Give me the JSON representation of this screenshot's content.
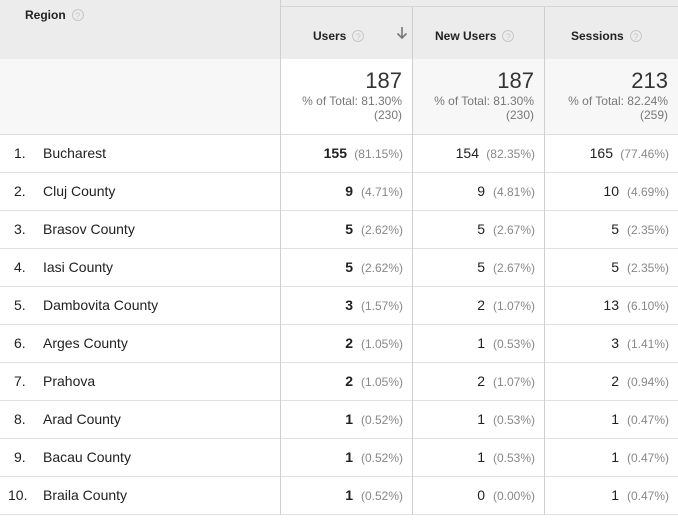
{
  "columns": {
    "region": "Region",
    "users": "Users",
    "new_users": "New Users",
    "sessions": "Sessions",
    "help_glyph": "?"
  },
  "totals": {
    "users": {
      "value": "187",
      "pct": "% of Total: 81.30%",
      "base": "(230)"
    },
    "new_users": {
      "value": "187",
      "pct": "% of Total: 81.30%",
      "base": "(230)"
    },
    "sessions": {
      "value": "213",
      "pct": "% of Total: 82.24%",
      "base": "(259)"
    }
  },
  "rows": [
    {
      "idx": "1.",
      "region": "Bucharest",
      "users": "155",
      "users_pct": "(81.15%)",
      "new": "154",
      "new_pct": "(82.35%)",
      "sess": "165",
      "sess_pct": "(77.46%)"
    },
    {
      "idx": "2.",
      "region": "Cluj County",
      "users": "9",
      "users_pct": "(4.71%)",
      "new": "9",
      "new_pct": "(4.81%)",
      "sess": "10",
      "sess_pct": "(4.69%)"
    },
    {
      "idx": "3.",
      "region": "Brasov County",
      "users": "5",
      "users_pct": "(2.62%)",
      "new": "5",
      "new_pct": "(2.67%)",
      "sess": "5",
      "sess_pct": "(2.35%)"
    },
    {
      "idx": "4.",
      "region": "Iasi County",
      "users": "5",
      "users_pct": "(2.62%)",
      "new": "5",
      "new_pct": "(2.67%)",
      "sess": "5",
      "sess_pct": "(2.35%)"
    },
    {
      "idx": "5.",
      "region": "Dambovita County",
      "users": "3",
      "users_pct": "(1.57%)",
      "new": "2",
      "new_pct": "(1.07%)",
      "sess": "13",
      "sess_pct": "(6.10%)"
    },
    {
      "idx": "6.",
      "region": "Arges County",
      "users": "2",
      "users_pct": "(1.05%)",
      "new": "1",
      "new_pct": "(0.53%)",
      "sess": "3",
      "sess_pct": "(1.41%)"
    },
    {
      "idx": "7.",
      "region": "Prahova",
      "users": "2",
      "users_pct": "(1.05%)",
      "new": "2",
      "new_pct": "(1.07%)",
      "sess": "2",
      "sess_pct": "(0.94%)"
    },
    {
      "idx": "8.",
      "region": "Arad County",
      "users": "1",
      "users_pct": "(0.52%)",
      "new": "1",
      "new_pct": "(0.53%)",
      "sess": "1",
      "sess_pct": "(0.47%)"
    },
    {
      "idx": "9.",
      "region": "Bacau County",
      "users": "1",
      "users_pct": "(0.52%)",
      "new": "1",
      "new_pct": "(0.53%)",
      "sess": "1",
      "sess_pct": "(0.47%)"
    },
    {
      "idx": "10.",
      "region": "Braila County",
      "users": "1",
      "users_pct": "(0.52%)",
      "new": "0",
      "new_pct": "(0.00%)",
      "sess": "1",
      "sess_pct": "(0.47%)"
    }
  ],
  "sort": {
    "column": "users",
    "direction": "descending",
    "icon": "arrow-down-icon"
  }
}
